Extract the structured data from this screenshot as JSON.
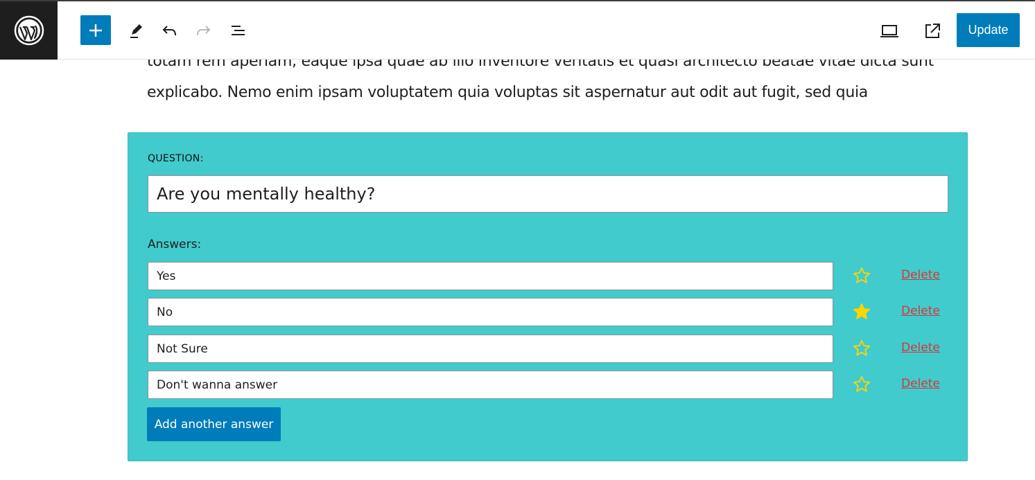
{
  "toolbar": {
    "logo_icon": "wordpress-icon",
    "add_block_icon": "plus-icon",
    "tools_icon": "pencil-icon",
    "undo_icon": "undo-icon",
    "redo_icon": "redo-icon",
    "list_view_icon": "list-view-icon",
    "preview_icon": "desktop-preview-icon",
    "view_post_icon": "external-link-icon",
    "update_label": "Update",
    "accent_color": "#007cba"
  },
  "content": {
    "lines": [
      "totam rem aperiam, eaque ipsa quae ab illo inventore veritatis et quasi architecto beatae vitae dicta sunt",
      "explicabo. Nemo enim ipsam voluptatem quia voluptas sit aspernatur aut odit aut fugit, sed quia"
    ]
  },
  "quiz": {
    "background_color": "#41cbcd",
    "question_label": "QUESTION:",
    "question_value": "Are you mentally healthy?",
    "answers_label": "Answers:",
    "answers": [
      {
        "value": "Yes",
        "correct": false,
        "delete_label": "Delete"
      },
      {
        "value": "No",
        "correct": true,
        "delete_label": "Delete"
      },
      {
        "value": "Not Sure",
        "correct": false,
        "delete_label": "Delete"
      },
      {
        "value": "Don't wanna answer",
        "correct": false,
        "delete_label": "Delete"
      }
    ],
    "star_color": "#ffd500",
    "delete_color": "#d63638",
    "add_answer_label": "Add another answer"
  }
}
